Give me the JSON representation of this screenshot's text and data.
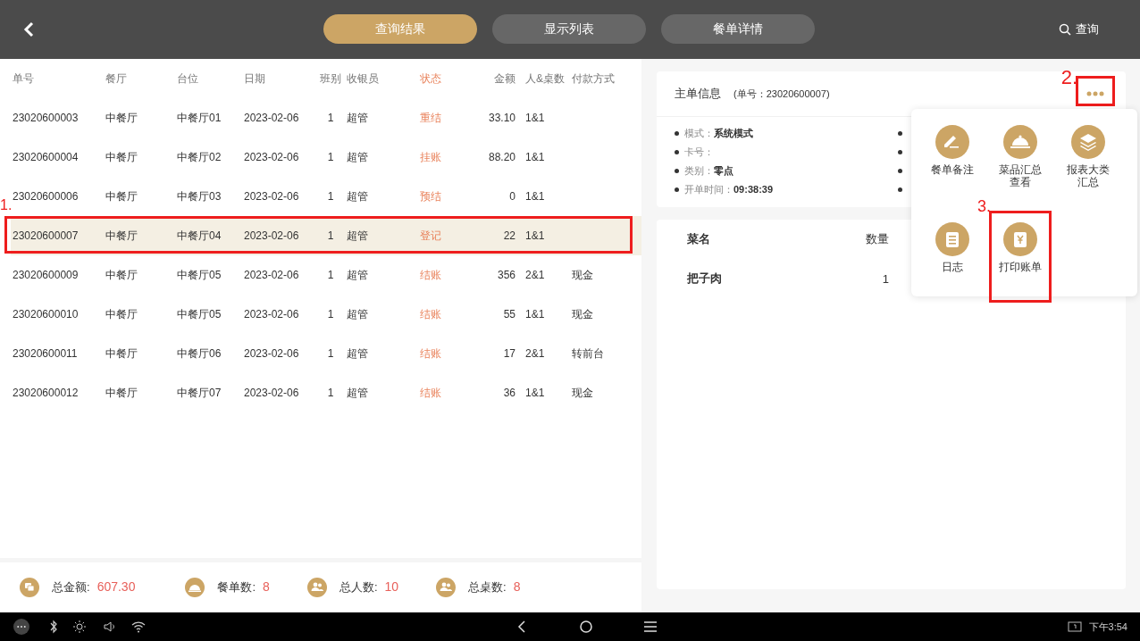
{
  "top_bar": {
    "tabs": [
      {
        "label": "查询结果",
        "selected": true
      },
      {
        "label": "显示列表",
        "selected": false
      },
      {
        "label": "餐单详情",
        "selected": false
      }
    ],
    "search_label": "查询"
  },
  "table": {
    "columns": [
      "单号",
      "餐厅",
      "台位",
      "日期",
      "班别",
      "收银员",
      "状态",
      "金额",
      "人&桌数",
      "付款方式"
    ],
    "rows": [
      {
        "cells": [
          "23020600003",
          "中餐厅",
          "中餐厅01",
          "2023-02-06",
          "1",
          "超管",
          "重结",
          "33.10",
          "1&1",
          ""
        ],
        "selected": false
      },
      {
        "cells": [
          "23020600004",
          "中餐厅",
          "中餐厅02",
          "2023-02-06",
          "1",
          "超管",
          "挂账",
          "88.20",
          "1&1",
          ""
        ],
        "selected": false
      },
      {
        "cells": [
          "23020600006",
          "中餐厅",
          "中餐厅03",
          "2023-02-06",
          "1",
          "超管",
          "预结",
          "0",
          "1&1",
          ""
        ],
        "selected": false
      },
      {
        "cells": [
          "23020600007",
          "中餐厅",
          "中餐厅04",
          "2023-02-06",
          "1",
          "超管",
          "登记",
          "22",
          "1&1",
          ""
        ],
        "selected": true,
        "annotation": "1."
      },
      {
        "cells": [
          "23020600009",
          "中餐厅",
          "中餐厅05",
          "2023-02-06",
          "1",
          "超管",
          "结账",
          "356",
          "2&1",
          "现金"
        ],
        "selected": false
      },
      {
        "cells": [
          "23020600010",
          "中餐厅",
          "中餐厅05",
          "2023-02-06",
          "1",
          "超管",
          "结账",
          "55",
          "1&1",
          "现金"
        ],
        "selected": false
      },
      {
        "cells": [
          "23020600011",
          "中餐厅",
          "中餐厅06",
          "2023-02-06",
          "1",
          "超管",
          "结账",
          "17",
          "2&1",
          "转前台"
        ],
        "selected": false
      },
      {
        "cells": [
          "23020600012",
          "中餐厅",
          "中餐厅07",
          "2023-02-06",
          "1",
          "超管",
          "结账",
          "36",
          "1&1",
          "现金"
        ],
        "selected": false
      }
    ]
  },
  "summary": [
    {
      "kind": "money",
      "label": "总金额:",
      "value": "607.30"
    },
    {
      "kind": "orders",
      "label": "餐单数:",
      "value": "8"
    },
    {
      "kind": "people",
      "label": "总人数:",
      "value": "10"
    },
    {
      "kind": "tables",
      "label": "总桌数:",
      "value": "8"
    }
  ],
  "order_info": {
    "title": "主单信息",
    "order_no": "(单号：23020600007)",
    "more_annotation": "2.",
    "fields": [
      {
        "label": "模式：",
        "value": "系统模式"
      },
      {
        "label": "卡号："
      },
      {
        "label": "类别：",
        "value": "零点"
      },
      {
        "label": "开单时间：",
        "value": "09:38:39"
      }
    ]
  },
  "dishes": {
    "columns": [
      "菜名",
      "数量"
    ],
    "rows": [
      {
        "name": "把子肉",
        "qty": "1"
      }
    ]
  },
  "menu": [
    {
      "kind": "pencil",
      "label": "餐单备注"
    },
    {
      "kind": "cloche",
      "label": "菜品汇总查看"
    },
    {
      "kind": "layers",
      "label": "报表大类汇总"
    },
    {
      "kind": "log",
      "label": "日志"
    },
    {
      "kind": "bill",
      "label": "打印账单",
      "annotation": "3."
    }
  ],
  "system_bar": {
    "time": "下午3:54"
  }
}
